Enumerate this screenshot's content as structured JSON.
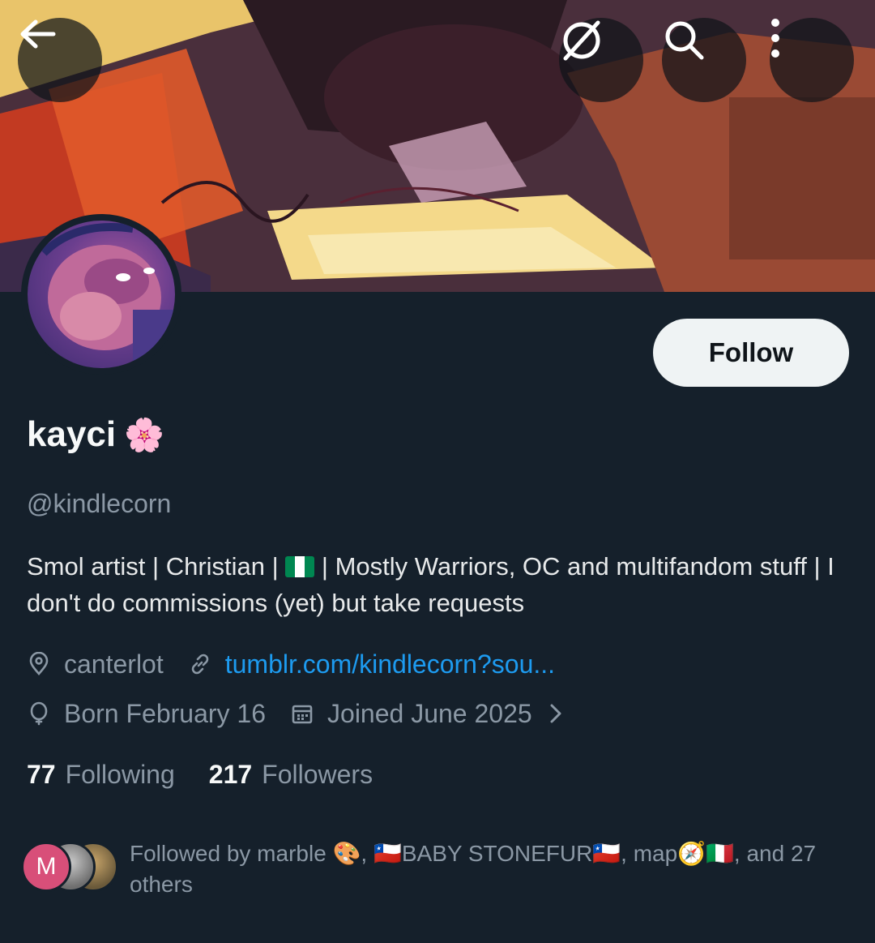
{
  "header": {
    "back_icon": "arrow-left-icon",
    "grok_icon": "grok-icon",
    "search_icon": "search-icon",
    "more_icon": "more-vertical-icon"
  },
  "profile": {
    "display_name": "kayci",
    "name_emoji": "🌸",
    "handle": "@kindlecorn",
    "follow_label": "Follow",
    "bio_part1": "Smol artist | Christian | ",
    "bio_part2": " | Mostly Warriors, OC and multifandom stuff | I don't do commissions (yet) but take requests",
    "location": "canterlot",
    "website": "tumblr.com/kindlecorn?sou...",
    "birthday": "Born February 16",
    "joined": "Joined June 2025",
    "following_count": "77",
    "following_label": "Following",
    "followers_count": "217",
    "followers_label": "Followers"
  },
  "followed_by": {
    "avatar_initial": "M",
    "text": "Followed by marble 🎨, 🇨🇱BABY STONEFUR🇨🇱, map🧭🇮🇹, and 27 others"
  },
  "colors": {
    "background": "#15202b",
    "accent_link": "#1d9bf0",
    "muted_text": "#8b98a5",
    "follow_button": "#eff3f4"
  }
}
